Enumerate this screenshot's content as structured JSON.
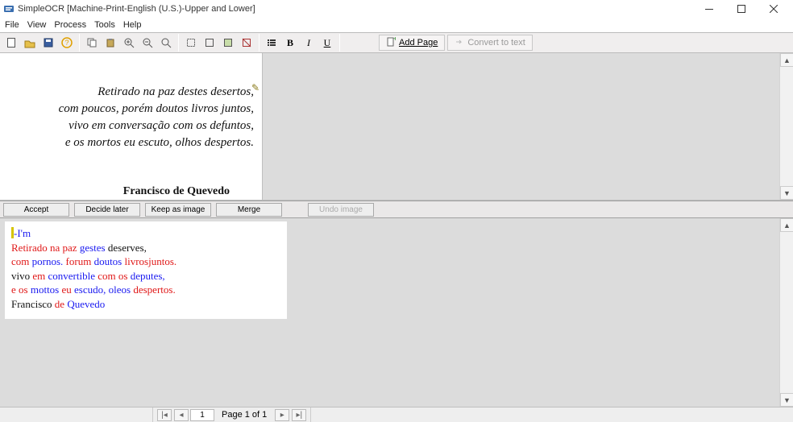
{
  "title_bar": {
    "title": "SimpleOCR [Machine-Print-English (U.S.)-Upper and Lower]"
  },
  "menu": {
    "file": "File",
    "view": "View",
    "process": "Process",
    "tools": "Tools",
    "help": "Help"
  },
  "toolbar": {
    "add_page": "Add Page",
    "convert": "Convert to text"
  },
  "actions": {
    "accept": "Accept",
    "decide_later": "Decide later",
    "keep_as_image": "Keep as image",
    "merge": "Merge",
    "undo_image": "Undo image"
  },
  "source_poem": {
    "line1": "Retirado na paz destes desertos,",
    "line2": "com poucos, porém doutos livros juntos,",
    "line3": "vivo em conversação com os defuntos,",
    "line4": "e os mortos eu escuto, olhos despertos.",
    "author": "Francisco de Quevedo"
  },
  "ocr_result": {
    "l1a": "-I'm",
    "l2a": "Retirado na paz ",
    "l2b": "gestes ",
    "l2c": "deserves,",
    "l3a": "com ",
    "l3b": "pornos. ",
    "l3c": "forum ",
    "l3d": "doutos ",
    "l3e": "livrosjuntos.",
    "l4a": "vivo ",
    "l4b": "em ",
    "l4c": "convertible ",
    "l4d": "com os ",
    "l4e": "deputes,",
    "l5a": "e os ",
    "l5b": "mottos ",
    "l5c": "eu ",
    "l5d": "escudo, ",
    "l5e": "oleos ",
    "l5f": "despertos.",
    "l6a": "Francisco ",
    "l6b": "de ",
    "l6c": "Quevedo"
  },
  "status": {
    "page_current": "1",
    "page_label": "Page 1 of 1"
  }
}
